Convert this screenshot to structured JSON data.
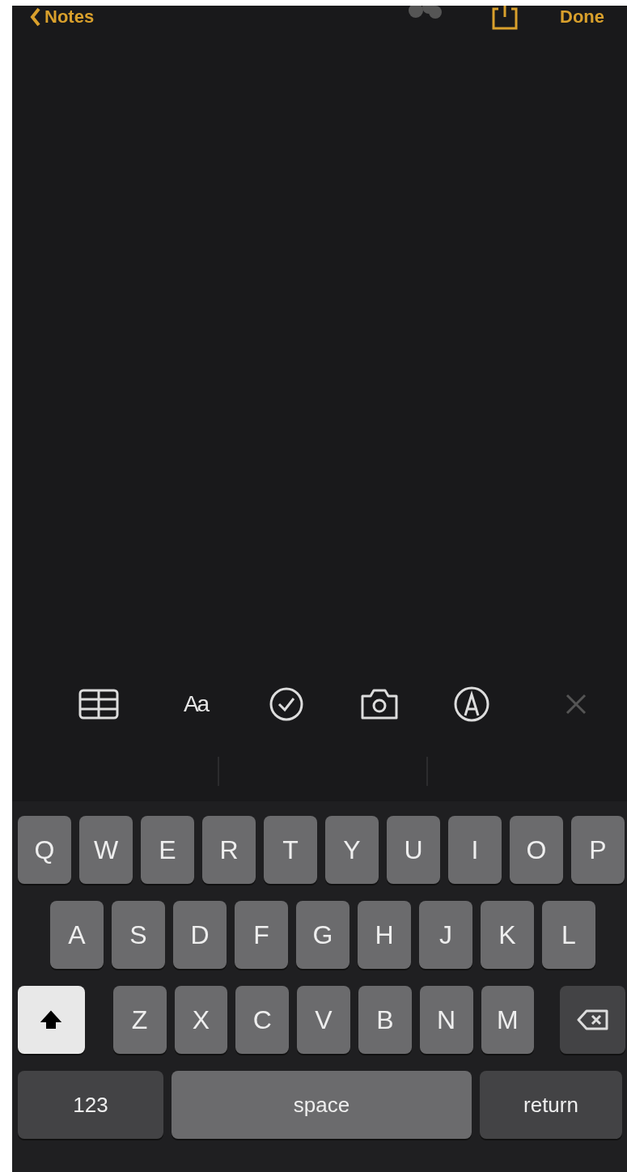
{
  "nav": {
    "back_label": "Notes",
    "done_label": "Done"
  },
  "toolbar": {
    "format_label": "Aa"
  },
  "keyboard": {
    "rows": [
      {
        "keys": [
          {
            "kind": "letter",
            "label": "Q"
          },
          {
            "kind": "letter",
            "label": "W"
          },
          {
            "kind": "letter",
            "label": "E"
          },
          {
            "kind": "letter",
            "label": "R"
          },
          {
            "kind": "letter",
            "label": "T"
          },
          {
            "kind": "letter",
            "label": "Y"
          },
          {
            "kind": "letter",
            "label": "U"
          },
          {
            "kind": "letter",
            "label": "I"
          },
          {
            "kind": "letter",
            "label": "O"
          },
          {
            "kind": "letter",
            "label": "P"
          }
        ]
      },
      {
        "keys": [
          {
            "kind": "letter",
            "label": "A"
          },
          {
            "kind": "letter",
            "label": "S"
          },
          {
            "kind": "letter",
            "label": "D"
          },
          {
            "kind": "letter",
            "label": "F"
          },
          {
            "kind": "letter",
            "label": "G"
          },
          {
            "kind": "letter",
            "label": "H"
          },
          {
            "kind": "letter",
            "label": "J"
          },
          {
            "kind": "letter",
            "label": "K"
          },
          {
            "kind": "letter",
            "label": "L"
          }
        ]
      },
      {
        "keys": [
          {
            "kind": "shift",
            "on": true
          },
          {
            "kind": "letter",
            "label": "Z"
          },
          {
            "kind": "letter",
            "label": "X"
          },
          {
            "kind": "letter",
            "label": "C"
          },
          {
            "kind": "letter",
            "label": "V"
          },
          {
            "kind": "letter",
            "label": "B"
          },
          {
            "kind": "letter",
            "label": "N"
          },
          {
            "kind": "letter",
            "label": "M"
          },
          {
            "kind": "delete"
          }
        ]
      },
      {
        "keys": [
          {
            "kind": "mode",
            "label": "123"
          },
          {
            "kind": "space",
            "label": "space"
          },
          {
            "kind": "return",
            "label": "return"
          }
        ]
      }
    ]
  }
}
